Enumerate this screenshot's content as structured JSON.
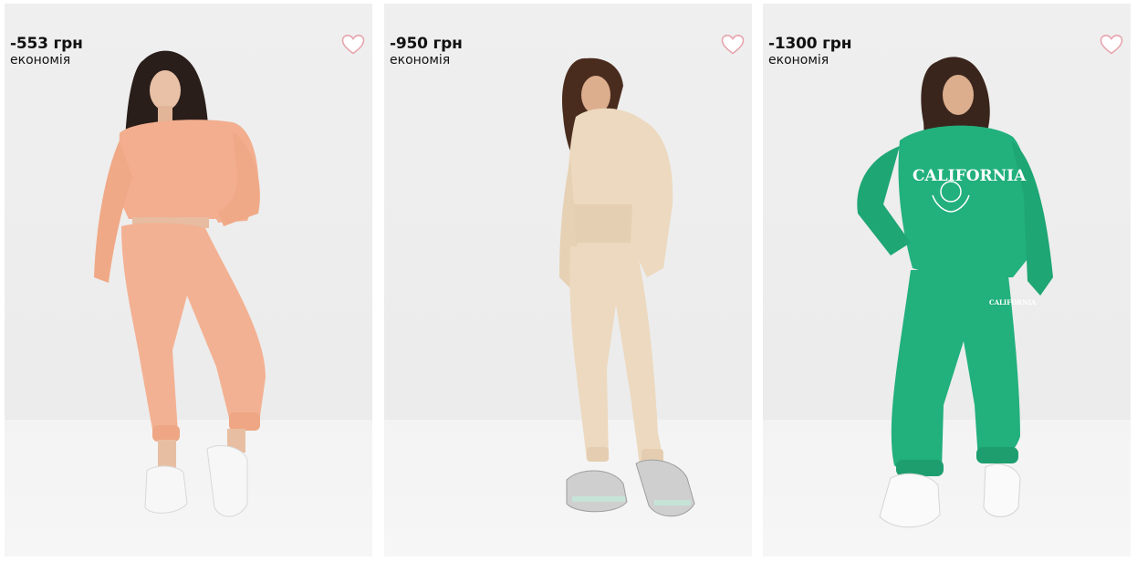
{
  "colors": {
    "card_bg": "#ededed",
    "heart_stroke": "#e8a4ae",
    "text": "#111111",
    "suit_peach": "#f3b193",
    "suit_beige": "#ecd9bf",
    "suit_green": "#22b07d"
  },
  "products": [
    {
      "discount": "-553 грн",
      "saving_label": "економія",
      "favorite_icon": "heart-outline-icon"
    },
    {
      "discount": "-950 грн",
      "saving_label": "економія",
      "favorite_icon": "heart-outline-icon"
    },
    {
      "discount": "-1300 грн",
      "saving_label": "економія",
      "favorite_icon": "heart-outline-icon"
    }
  ],
  "print": {
    "sweatshirt_text": "CALIFORNIA",
    "pants_text": "CALIFORNIA"
  }
}
